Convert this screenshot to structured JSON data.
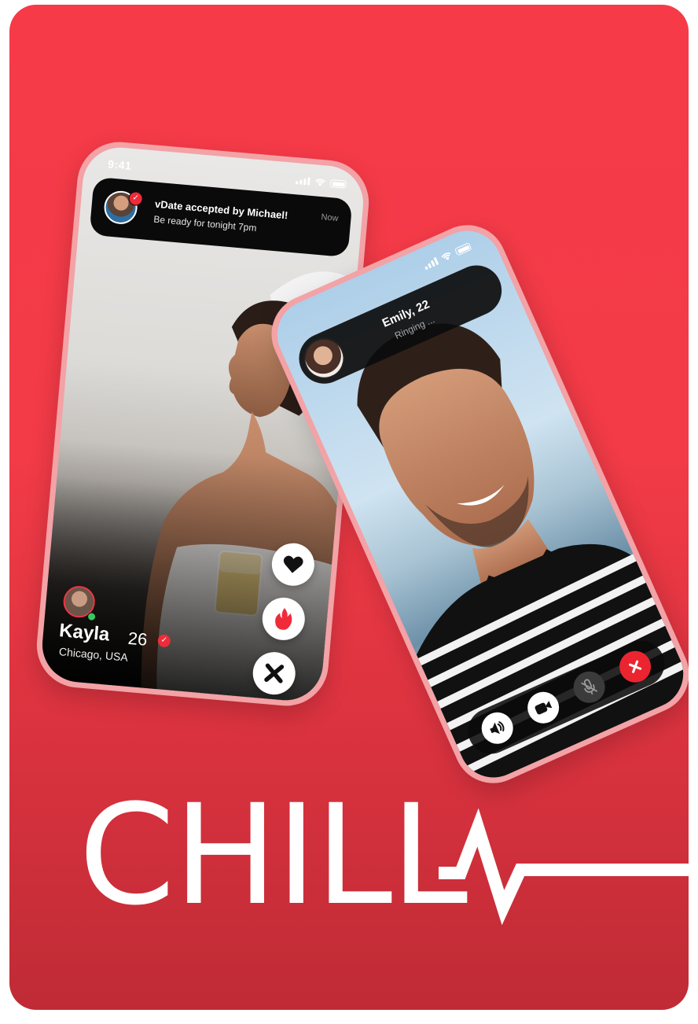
{
  "phone_one": {
    "status_time": "9:41",
    "notification": {
      "title": "vDate accepted by Michael!",
      "subtitle": "Be ready for tonight 7pm",
      "time": "Now"
    },
    "profile": {
      "name": "Kayla",
      "age": "26",
      "location": "Chicago, USA"
    },
    "actions": [
      {
        "label": "like",
        "icon": "heart-icon"
      },
      {
        "label": "super-like",
        "icon": "flame-icon"
      },
      {
        "label": "dislike",
        "icon": "close-icon"
      }
    ]
  },
  "phone_two": {
    "caller": {
      "name": "Emily, 22",
      "status": "Ringing ..."
    },
    "controls": [
      {
        "icon": "speaker-icon"
      },
      {
        "icon": "video-camera-icon"
      },
      {
        "icon": "microphone-muted-icon"
      },
      {
        "icon": "end-call-icon"
      }
    ]
  },
  "brand": {
    "logo_text": "CHILL"
  },
  "colors": {
    "background_red": "#f23b47",
    "accent_red": "#ef2b3a",
    "phone_frame": "#f3a2a6",
    "online_green": "#35c95b"
  }
}
